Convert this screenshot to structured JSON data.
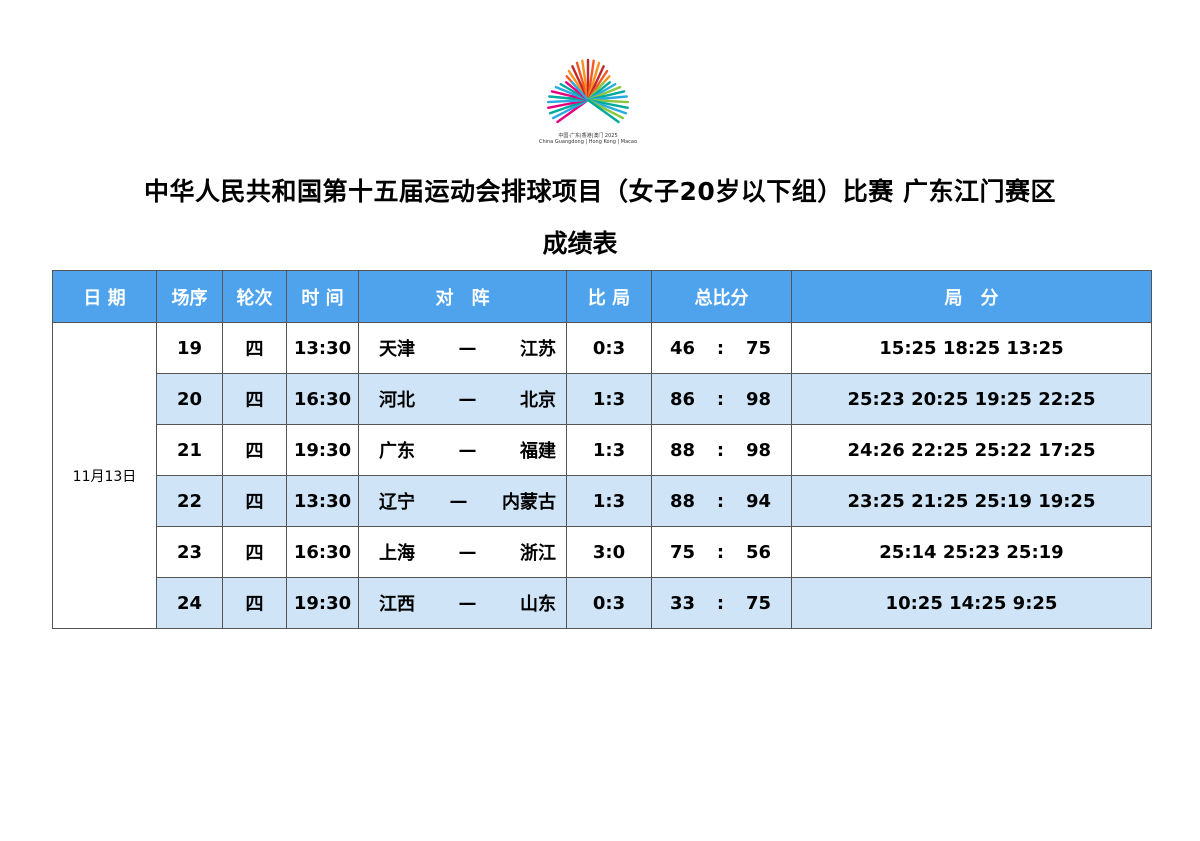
{
  "logo": {
    "text_line1": "中国·广东|香港|澳门 2025",
    "text_line2": "China Guangdong | Hong Kong | Macao",
    "colors": [
      "#f15a24",
      "#f7931e",
      "#e6007e",
      "#8cc63f",
      "#00a99d",
      "#29abe2",
      "#c1272d"
    ]
  },
  "title": "中华人民共和国第十五届运动会排球项目（女子20岁以下组）比赛 广东江门赛区",
  "subtitle": "成绩表",
  "headers": {
    "date": "日 期",
    "match_no": "场序",
    "round": "轮次",
    "time": "时 间",
    "matchup": "对　阵",
    "sets": "比 局",
    "points": "总比分",
    "set_scores": "局　分"
  },
  "date": "11月13日",
  "dash": "—",
  "colon": ":",
  "rows": [
    {
      "no": "19",
      "round": "四",
      "time": "13:30",
      "team_a": "天津",
      "team_b": "江苏",
      "sets": "0:3",
      "pts_a": "46",
      "pts_b": "75",
      "set_scores": "15:25 18:25 13:25"
    },
    {
      "no": "20",
      "round": "四",
      "time": "16:30",
      "team_a": "河北",
      "team_b": "北京",
      "sets": "1:3",
      "pts_a": "86",
      "pts_b": "98",
      "set_scores": "25:23 20:25 19:25 22:25"
    },
    {
      "no": "21",
      "round": "四",
      "time": "19:30",
      "team_a": "广东",
      "team_b": "福建",
      "sets": "1:3",
      "pts_a": "88",
      "pts_b": "98",
      "set_scores": "24:26 22:25 25:22 17:25"
    },
    {
      "no": "22",
      "round": "四",
      "time": "13:30",
      "team_a": "辽宁",
      "team_b": "内蒙古",
      "sets": "1:3",
      "pts_a": "88",
      "pts_b": "94",
      "set_scores": "23:25 21:25 25:19 19:25"
    },
    {
      "no": "23",
      "round": "四",
      "time": "16:30",
      "team_a": "上海",
      "team_b": "浙江",
      "sets": "3:0",
      "pts_a": "75",
      "pts_b": "56",
      "set_scores": "25:14 25:23 25:19"
    },
    {
      "no": "24",
      "round": "四",
      "time": "19:30",
      "team_a": "江西",
      "team_b": "山东",
      "sets": "0:3",
      "pts_a": "33",
      "pts_b": "75",
      "set_scores": "10:25 14:25 9:25"
    }
  ]
}
